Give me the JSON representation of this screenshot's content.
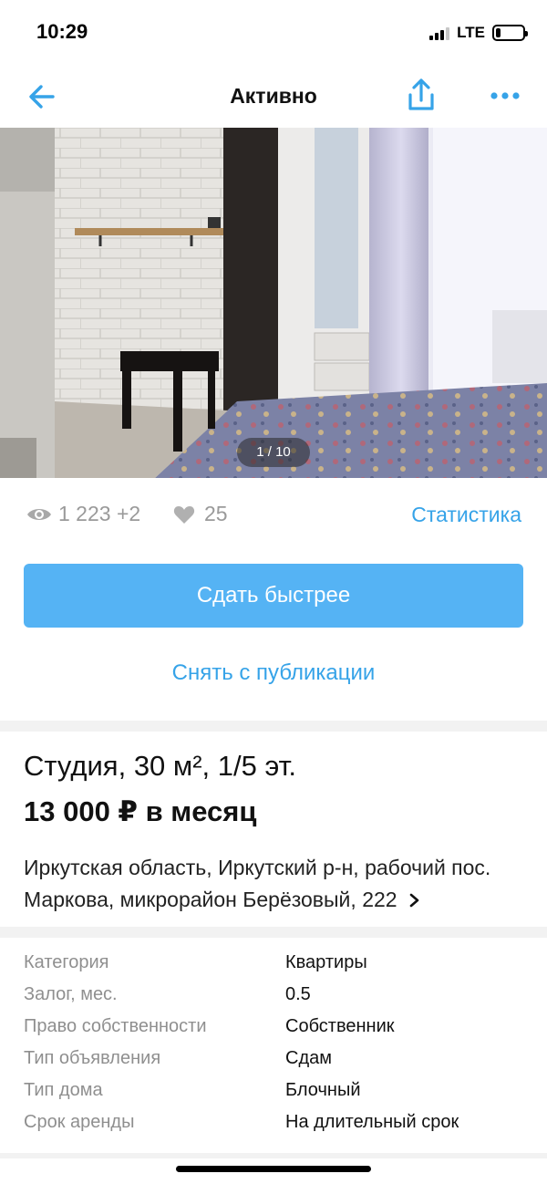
{
  "status": {
    "time": "10:29",
    "network": "LTE"
  },
  "nav": {
    "title": "Активно",
    "back_icon": "arrow-left-icon",
    "share_icon": "share-icon",
    "more_icon": "more-icon",
    "accent": "#36a3e8"
  },
  "gallery": {
    "counter": "1 / 10"
  },
  "stats": {
    "views": "1 223 +2",
    "likes": "25",
    "statistics_link": "Статистика"
  },
  "actions": {
    "promote_label": "Сдать быстрее",
    "unpublish_label": "Снять с публикации"
  },
  "listing": {
    "title": "Студия, 30 м², 1/5 эт.",
    "price": "13 000 ₽ в месяц",
    "address": "Иркутская область, Иркутский р-н, рабочий пос. Маркова, микрорайон Берёзовый, 222"
  },
  "params": [
    {
      "key": "Категория",
      "value": "Квартиры"
    },
    {
      "key": "Залог, мес.",
      "value": "0.5"
    },
    {
      "key": "Право собственности",
      "value": "Собственник"
    },
    {
      "key": "Тип объявления",
      "value": "Сдам"
    },
    {
      "key": "Тип дома",
      "value": "Блочный"
    },
    {
      "key": "Срок аренды",
      "value": "На длительный срок"
    }
  ]
}
